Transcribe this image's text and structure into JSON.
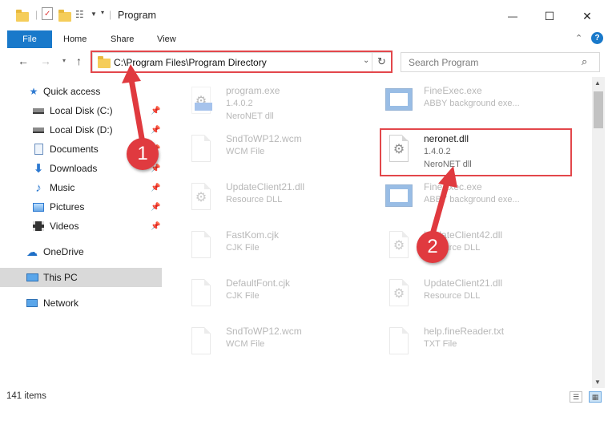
{
  "window": {
    "title": "Program",
    "controls": {
      "minimize": "—",
      "maximize": "☐",
      "close": "✕"
    }
  },
  "ribbon": {
    "tabs": [
      "File",
      "Home",
      "Share",
      "View"
    ],
    "collapse_icon": "chevron-up-icon",
    "help_icon": "?"
  },
  "addressbar": {
    "path": "C:\\Program Files\\Program Directory",
    "search_placeholder": "Search Program"
  },
  "navpane": {
    "items": [
      {
        "label": "Quick access",
        "icon": "star-icon",
        "pinned": false
      },
      {
        "label": "Local Disk (C:)",
        "icon": "drive-icon",
        "pinned": true
      },
      {
        "label": "Local Disk (D:)",
        "icon": "drive-icon",
        "pinned": true
      },
      {
        "label": "Documents",
        "icon": "documents-icon",
        "pinned": true
      },
      {
        "label": "Downloads",
        "icon": "download-icon",
        "pinned": true
      },
      {
        "label": "Music",
        "icon": "music-icon",
        "pinned": true
      },
      {
        "label": "Pictures",
        "icon": "pictures-icon",
        "pinned": true
      },
      {
        "label": "Videos",
        "icon": "videos-icon",
        "pinned": true
      },
      {
        "label": "OneDrive",
        "icon": "cloud-icon",
        "pinned": false
      },
      {
        "label": "This PC",
        "icon": "computer-icon",
        "pinned": false,
        "selected": true
      },
      {
        "label": "Network",
        "icon": "network-icon",
        "pinned": false
      }
    ]
  },
  "files": [
    {
      "name": "program.exe",
      "line2": "1.4.0.2",
      "line3": "NeroNET dll",
      "icon": "exe",
      "faded": true
    },
    {
      "name": "FineExec.exe",
      "line2": "ABBY background exe...",
      "line3": "",
      "icon": "app",
      "faded": true
    },
    {
      "name": "SndToWP12.wcm",
      "line2": "WCM File",
      "line3": "",
      "icon": "doc",
      "faded": true
    },
    {
      "name": "neronet.dll",
      "line2": "1.4.0.2",
      "line3": "NeroNET dll",
      "icon": "dll",
      "faded": false
    },
    {
      "name": "UpdateClient21.dll",
      "line2": "Resource DLL",
      "line3": "",
      "icon": "dll",
      "faded": true
    },
    {
      "name": "FineExec.exe",
      "line2": "ABBY background exe...",
      "line3": "",
      "icon": "app",
      "faded": true
    },
    {
      "name": "FastKom.cjk",
      "line2": "CJK File",
      "line3": "",
      "icon": "doc",
      "faded": true
    },
    {
      "name": "UpdateClient42.dll",
      "line2": "Resource DLL",
      "line3": "",
      "icon": "dll",
      "faded": true
    },
    {
      "name": "DefaultFont.cjk",
      "line2": "CJK File",
      "line3": "",
      "icon": "doc",
      "faded": true
    },
    {
      "name": "UpdateClient21.dll",
      "line2": "Resource DLL",
      "line3": "",
      "icon": "dll",
      "faded": true
    },
    {
      "name": "SndToWP12.wcm",
      "line2": "WCM File",
      "line3": "",
      "icon": "doc",
      "faded": true
    },
    {
      "name": "help.fineReader.txt",
      "line2": "TXT File",
      "line3": "",
      "icon": "doc",
      "faded": true
    }
  ],
  "status": {
    "count": "141 items"
  },
  "callouts": [
    {
      "label": "1"
    },
    {
      "label": "2"
    }
  ],
  "colors": {
    "accent": "#1979ca",
    "highlight": "#e3474b",
    "badge": "#e03a3f"
  }
}
